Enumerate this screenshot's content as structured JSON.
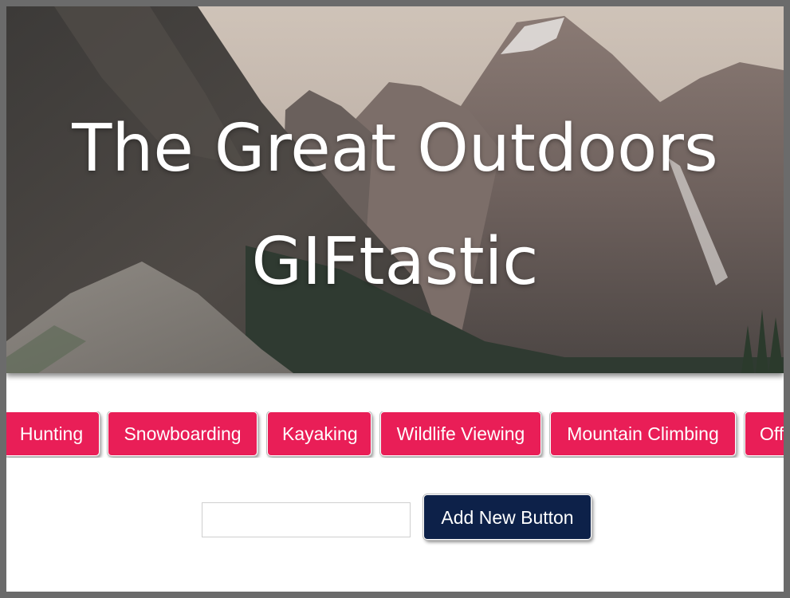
{
  "header": {
    "title_line1": "The Great Outdoors",
    "title_line2": "GIFtastic",
    "background": "mountain-landscape-image"
  },
  "topic_buttons": [
    {
      "label": "Hunting"
    },
    {
      "label": "Snowboarding"
    },
    {
      "label": "Kayaking"
    },
    {
      "label": "Wildlife Viewing"
    },
    {
      "label": "Mountain Climbing"
    },
    {
      "label": "Off"
    }
  ],
  "form": {
    "input_value": "",
    "input_placeholder": "",
    "add_button_label": "Add New Button"
  },
  "colors": {
    "topic_button": "#e91e57",
    "add_button": "#0d2149",
    "page_frame": "#6b6b6b"
  }
}
